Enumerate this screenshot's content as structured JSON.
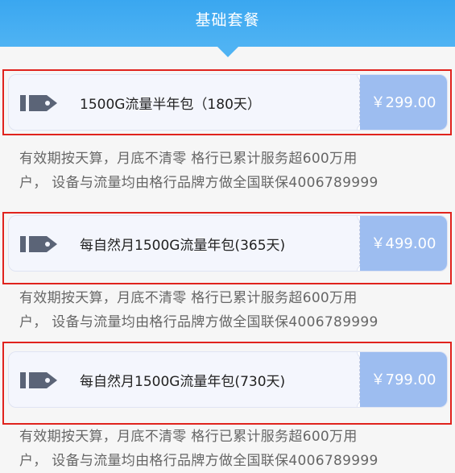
{
  "header": {
    "title": "基础套餐"
  },
  "packages": [
    {
      "name": "1500G流量半年包（180天）",
      "price": "￥299.00",
      "desc_line1": "有效期按天算，月底不清零 格行已累计服务超600万用",
      "desc_line2": "户， 设备与流量均由格行品牌方做全国联保4006789999"
    },
    {
      "name": "每自然月1500G流量年包(365天)",
      "price": "￥499.00",
      "desc_line1": "有效期按天算，月底不清零 格行已累计服务超600万用",
      "desc_line2": "户， 设备与流量均由格行品牌方做全国联保4006789999"
    },
    {
      "name": "每自然月1500G流量年包(730天)",
      "price": "￥799.00",
      "desc_line1": "有效期按天算，月底不清零 格行已累计服务超600万用",
      "desc_line2": "户， 设备与流量均由格行品牌方做全国联保4006789999"
    }
  ],
  "icons": {
    "tag": "price-tag-icon"
  },
  "colors": {
    "header": "#3aa7f0",
    "price_box": "#9dbdf0",
    "selection": "#e0231d"
  }
}
